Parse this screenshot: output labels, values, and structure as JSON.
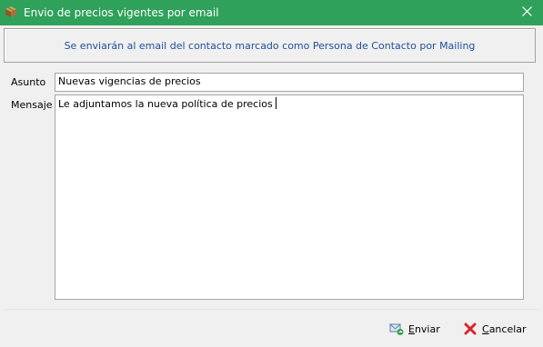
{
  "window": {
    "title": "Envio de precios vigentes por email",
    "icon": "package-icon"
  },
  "info": {
    "text": "Se enviarán al email del contacto marcado como Persona de Contacto por Mailing"
  },
  "form": {
    "asunto_label": "Asunto",
    "asunto_value": "Nuevas vigencias de precios",
    "mensaje_label": "Mensaje",
    "mensaje_value": "Le adjuntamos la nueva política de precios"
  },
  "buttons": {
    "enviar_first": "E",
    "enviar_rest": "nviar",
    "cancelar_first": "C",
    "cancelar_rest": "ancelar"
  },
  "colors": {
    "titlebar": "#2fa15a",
    "info_text": "#1f4e9b"
  }
}
